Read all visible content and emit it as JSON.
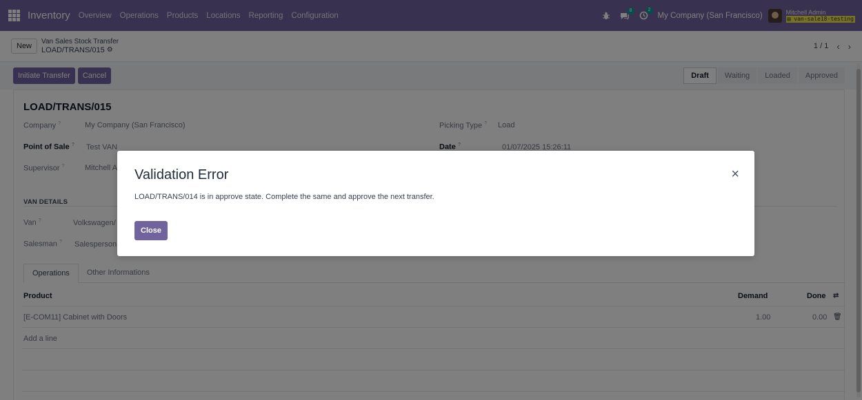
{
  "navbar": {
    "app_name": "Inventory",
    "menu": [
      "Overview",
      "Operations",
      "Products",
      "Locations",
      "Reporting",
      "Configuration"
    ],
    "messages_badge": "8",
    "activities_badge": "2",
    "company": "My Company (San Francisco)",
    "user_name": "Mitchell Admin",
    "database": "van-sale18-testing"
  },
  "control_panel": {
    "new_label": "New",
    "breadcrumb_parent": "Van Sales Stock Transfer",
    "breadcrumb_current": "LOAD/TRANS/015",
    "pager_value": "1 / 1"
  },
  "actions": {
    "initiate_label": "Initiate Transfer",
    "cancel_label": "Cancel",
    "stages": [
      "Draft",
      "Waiting",
      "Loaded",
      "Approved"
    ],
    "active_stage": "Draft"
  },
  "form": {
    "title": "LOAD/TRANS/015",
    "company_label": "Company",
    "company_value": "My Company (San Francisco)",
    "pos_label": "Point of Sale",
    "pos_value": "Test VAN",
    "supervisor_label": "Supervisor",
    "supervisor_value": "Mitchell Admin",
    "picking_type_label": "Picking Type",
    "picking_type_value": "Load",
    "date_label": "Date",
    "date_value": "01/07/2025 15:26:11",
    "help_mark": "?",
    "van_details_title": "VAN DETAILS",
    "van_label": "Van",
    "van_value": "Volkswagen/",
    "salesman_label": "Salesman",
    "salesman_value": "Salesperson"
  },
  "tabs": [
    "Operations",
    "Other Informations"
  ],
  "table": {
    "col_product": "Product",
    "col_demand": "Demand",
    "col_done": "Done",
    "rows": [
      {
        "product": "[E-COM11] Cabinet with Doors",
        "demand": "1.00",
        "done": "0.00"
      }
    ],
    "add_line_label": "Add a line"
  },
  "dialog": {
    "title": "Validation Error",
    "message": "LOAD/TRANS/014 is in approve state. Complete the same and approve the next transfer.",
    "close_label": "Close"
  },
  "colors": {
    "brand": "#71639e",
    "overlay": "rgba(0,0,0,0.5)"
  }
}
